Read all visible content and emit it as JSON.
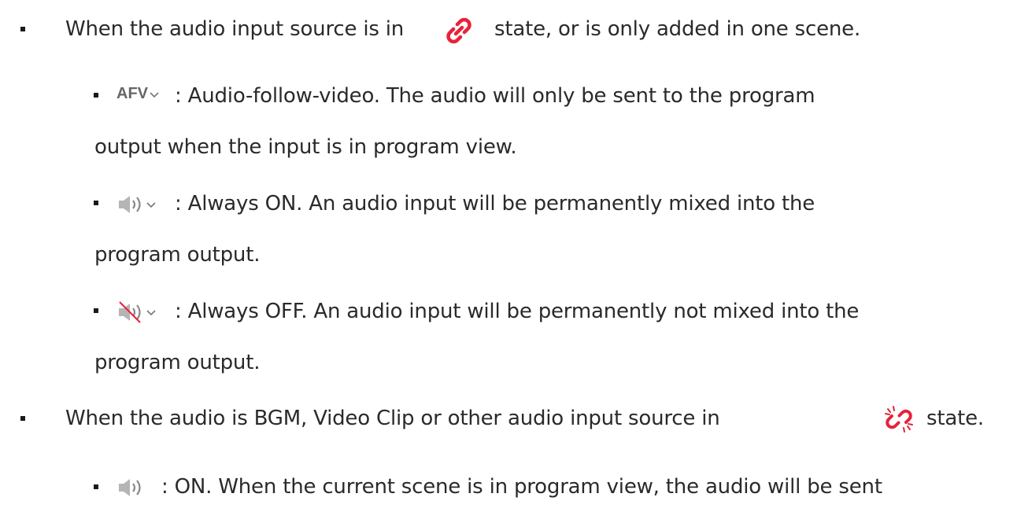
{
  "items": [
    {
      "level": 1,
      "text_before": "When the audio input source is in",
      "icon": "linked-chain-icon",
      "text_after": "state, or is only added in one scene."
    },
    {
      "level": 2,
      "icon": "afv-dropdown-icon",
      "icon_label": "AFV",
      "line1": ": Audio-follow-video. The audio will only be sent to the program",
      "line2": "output when the input is in program view."
    },
    {
      "level": 2,
      "icon": "speaker-on-dropdown-icon",
      "line1": ": Always ON. An audio input will be permanently mixed into the",
      "line2": "program output."
    },
    {
      "level": 2,
      "icon": "speaker-muted-dropdown-icon",
      "line1": ": Always OFF. An audio input will be permanently not mixed into the",
      "line2": "program output."
    },
    {
      "level": 1,
      "text_before": "When the audio is BGM, Video Clip or other audio input source in",
      "icon": "unlinked-chain-icon",
      "text_after": "state."
    },
    {
      "level": 2,
      "icon": "speaker-on-icon",
      "line1": ": ON. When the current scene is in program view, the audio will be sent"
    }
  ],
  "colors": {
    "text": "#2a2a2a",
    "icon_red": "#e8223a",
    "icon_gray": "#8a8a8a"
  }
}
